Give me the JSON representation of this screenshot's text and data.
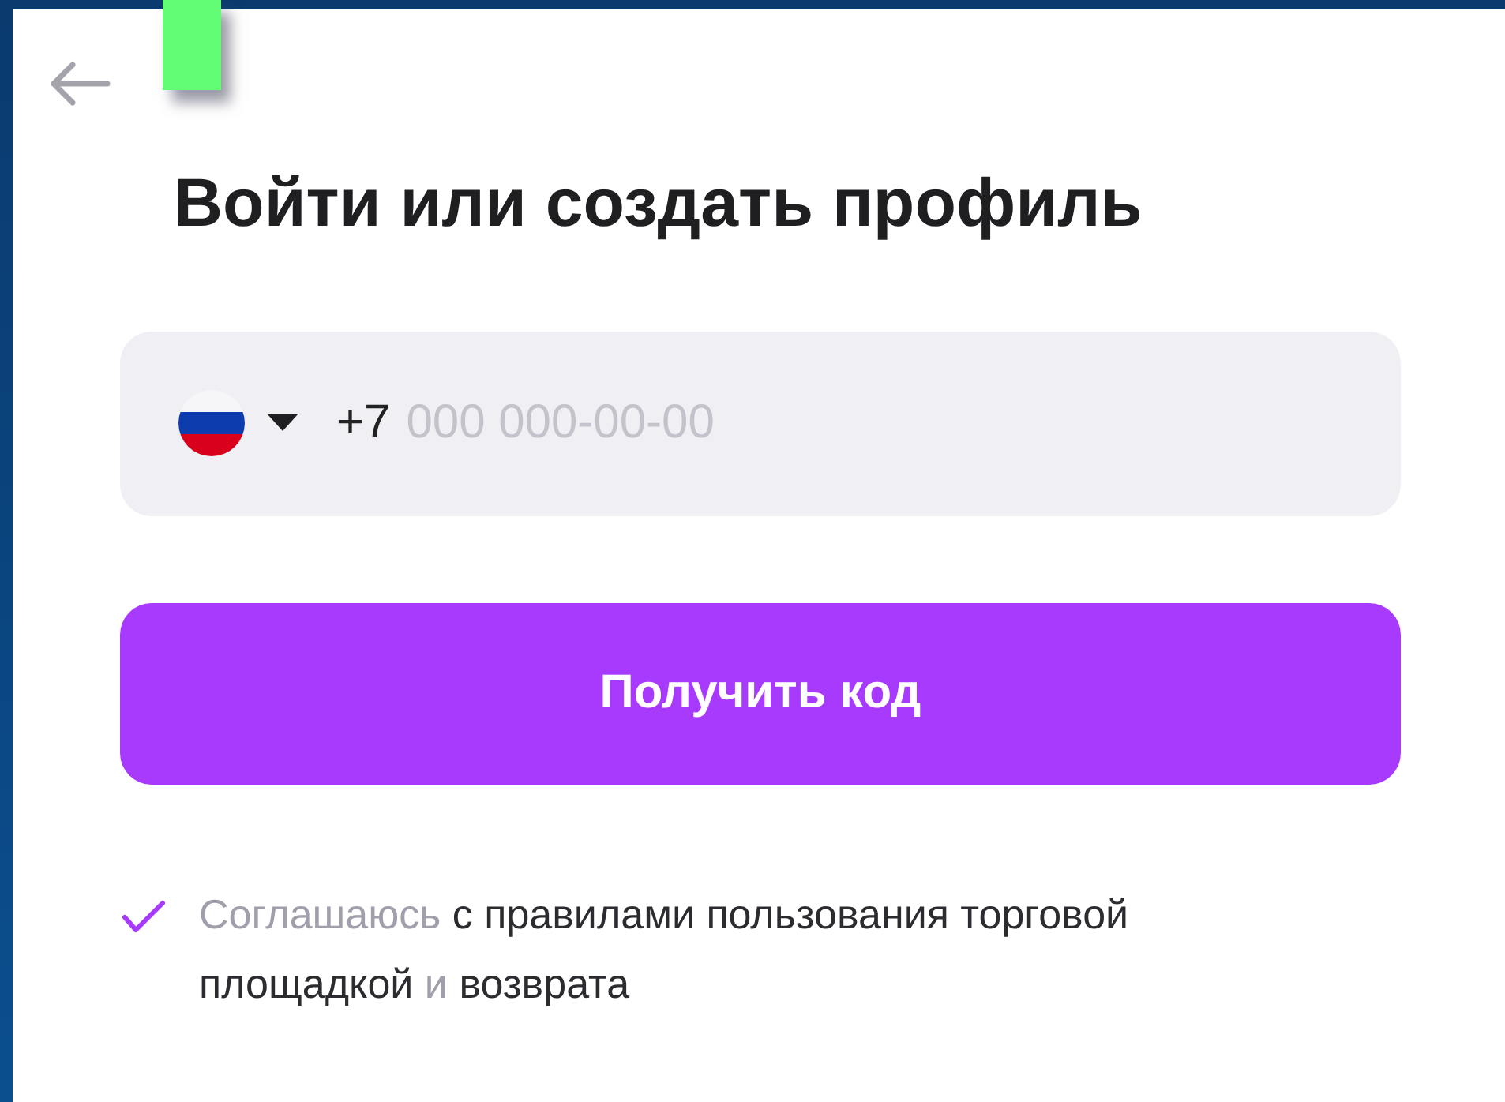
{
  "title": "Войти или создать профиль",
  "phone_field": {
    "country_code": "+7",
    "placeholder": "000 000-00-00"
  },
  "submit_button": {
    "label": "Получить код"
  },
  "consent": {
    "checked": true,
    "segments": [
      {
        "kind": "plain",
        "text": "Соглашаюсь"
      },
      {
        "kind": "link",
        "text": "с правилами пользования торговой"
      },
      {
        "kind": "link",
        "text": "площадкой"
      },
      {
        "kind": "plain",
        "text": "и"
      },
      {
        "kind": "link",
        "text": "возврата"
      }
    ]
  }
}
